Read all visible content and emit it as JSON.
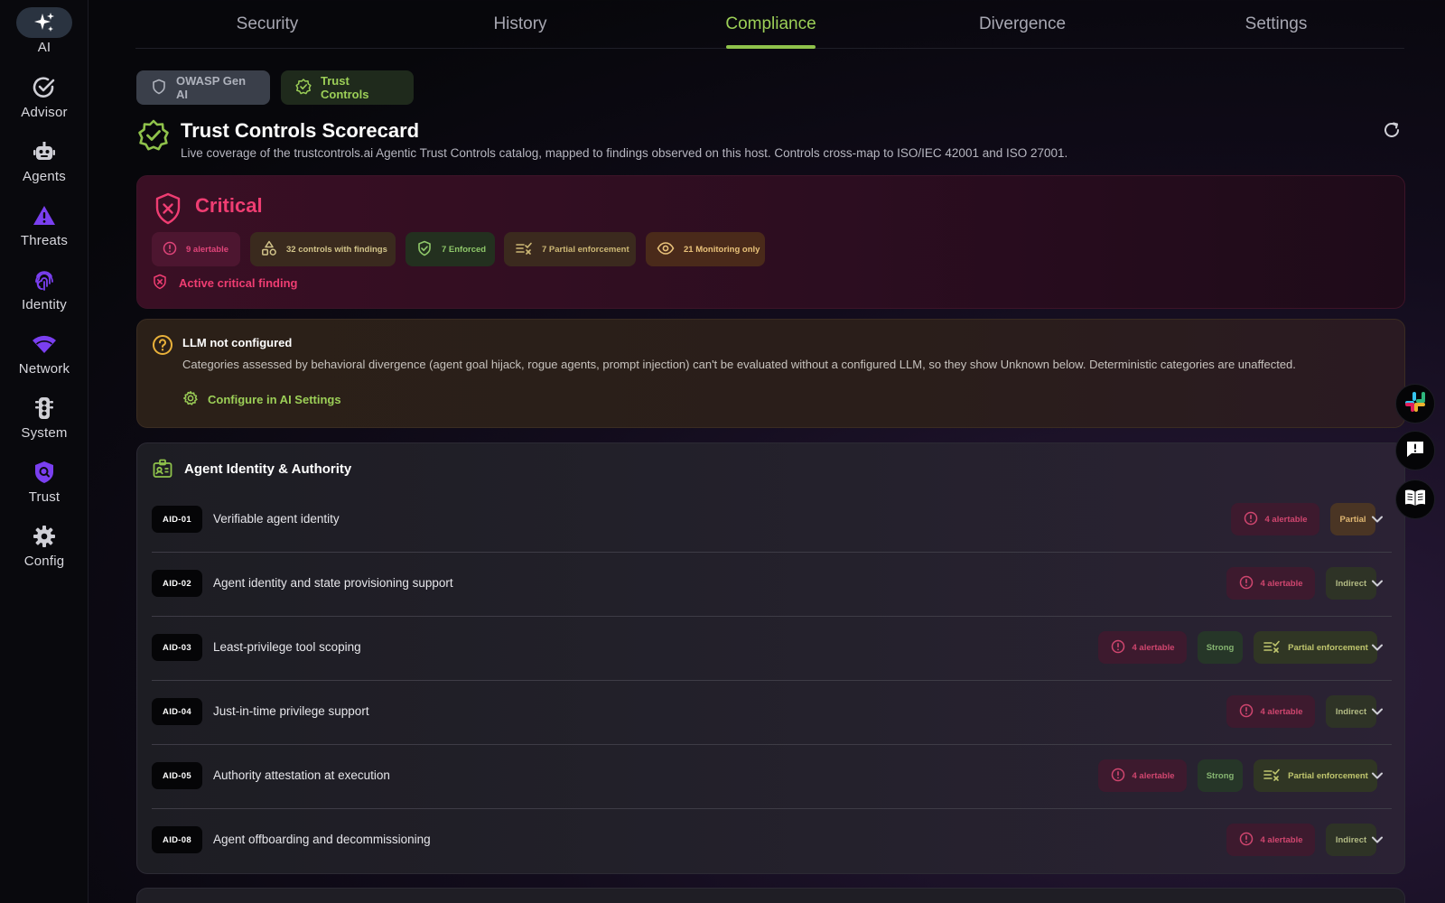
{
  "sidebar": {
    "items": [
      {
        "label": "AI",
        "icon": "sparkles-icon"
      },
      {
        "label": "Advisor",
        "icon": "check-circle-icon"
      },
      {
        "label": "Agents",
        "icon": "robot-icon"
      },
      {
        "label": "Threats",
        "icon": "warning-triangle-icon"
      },
      {
        "label": "Identity",
        "icon": "fingerprint-icon"
      },
      {
        "label": "Network",
        "icon": "wifi-icon"
      },
      {
        "label": "System",
        "icon": "traffic-light-icon"
      },
      {
        "label": "Trust",
        "icon": "shield-search-icon"
      },
      {
        "label": "Config",
        "icon": "gear-icon"
      }
    ],
    "active": "AI"
  },
  "tabs": [
    {
      "label": "Security"
    },
    {
      "label": "History"
    },
    {
      "label": "Compliance"
    },
    {
      "label": "Divergence"
    },
    {
      "label": "Settings"
    }
  ],
  "active_tab": "Compliance",
  "subtabs": {
    "owasp": "OWASP Gen AI",
    "trust": "Trust Controls",
    "active": "Trust Controls"
  },
  "header": {
    "title": "Trust Controls Scorecard",
    "subtitle": "Live coverage of the trustcontrols.ai Agentic Trust Controls catalog, mapped to findings observed on this host. Controls cross-map to ISO/IEC 42001 and ISO 27001."
  },
  "status": {
    "level": "Critical",
    "alertable": "9 alertable",
    "findings": "32 controls with findings",
    "enforced": "7 Enforced",
    "partial": "7 Partial enforcement",
    "monitoring": "21 Monitoring only",
    "active_finding": "Active critical finding"
  },
  "llm_notice": {
    "title": "LLM not configured",
    "body": "Categories assessed by behavioral divergence (agent goal hijack, rogue agents, prompt injection) can't be evaluated without a configured LLM, so they show Unknown below. Deterministic categories are unaffected.",
    "link": "Configure in AI Settings"
  },
  "section": {
    "title": "Agent Identity & Authority",
    "rows": [
      {
        "id": "AID-01",
        "name": "Verifiable agent identity",
        "alertable": "4 alertable",
        "level": "Partial"
      },
      {
        "id": "AID-02",
        "name": "Agent identity and state provisioning support",
        "alertable": "4 alertable",
        "level": "Indirect"
      },
      {
        "id": "AID-03",
        "name": "Least-privilege tool scoping",
        "alertable": "4 alertable",
        "level": "Strong",
        "enforcement": "Partial enforcement"
      },
      {
        "id": "AID-04",
        "name": "Just-in-time privilege support",
        "alertable": "4 alertable",
        "level": "Indirect"
      },
      {
        "id": "AID-05",
        "name": "Authority attestation at execution",
        "alertable": "4 alertable",
        "level": "Strong",
        "enforcement": "Partial enforcement"
      },
      {
        "id": "AID-08",
        "name": "Agent offboarding and decommissioning",
        "alertable": "4 alertable",
        "level": "Indirect"
      }
    ]
  },
  "colors": {
    "accent": "#9ccf57",
    "critical": "#ef3d72",
    "warning": "#e9b13a"
  }
}
